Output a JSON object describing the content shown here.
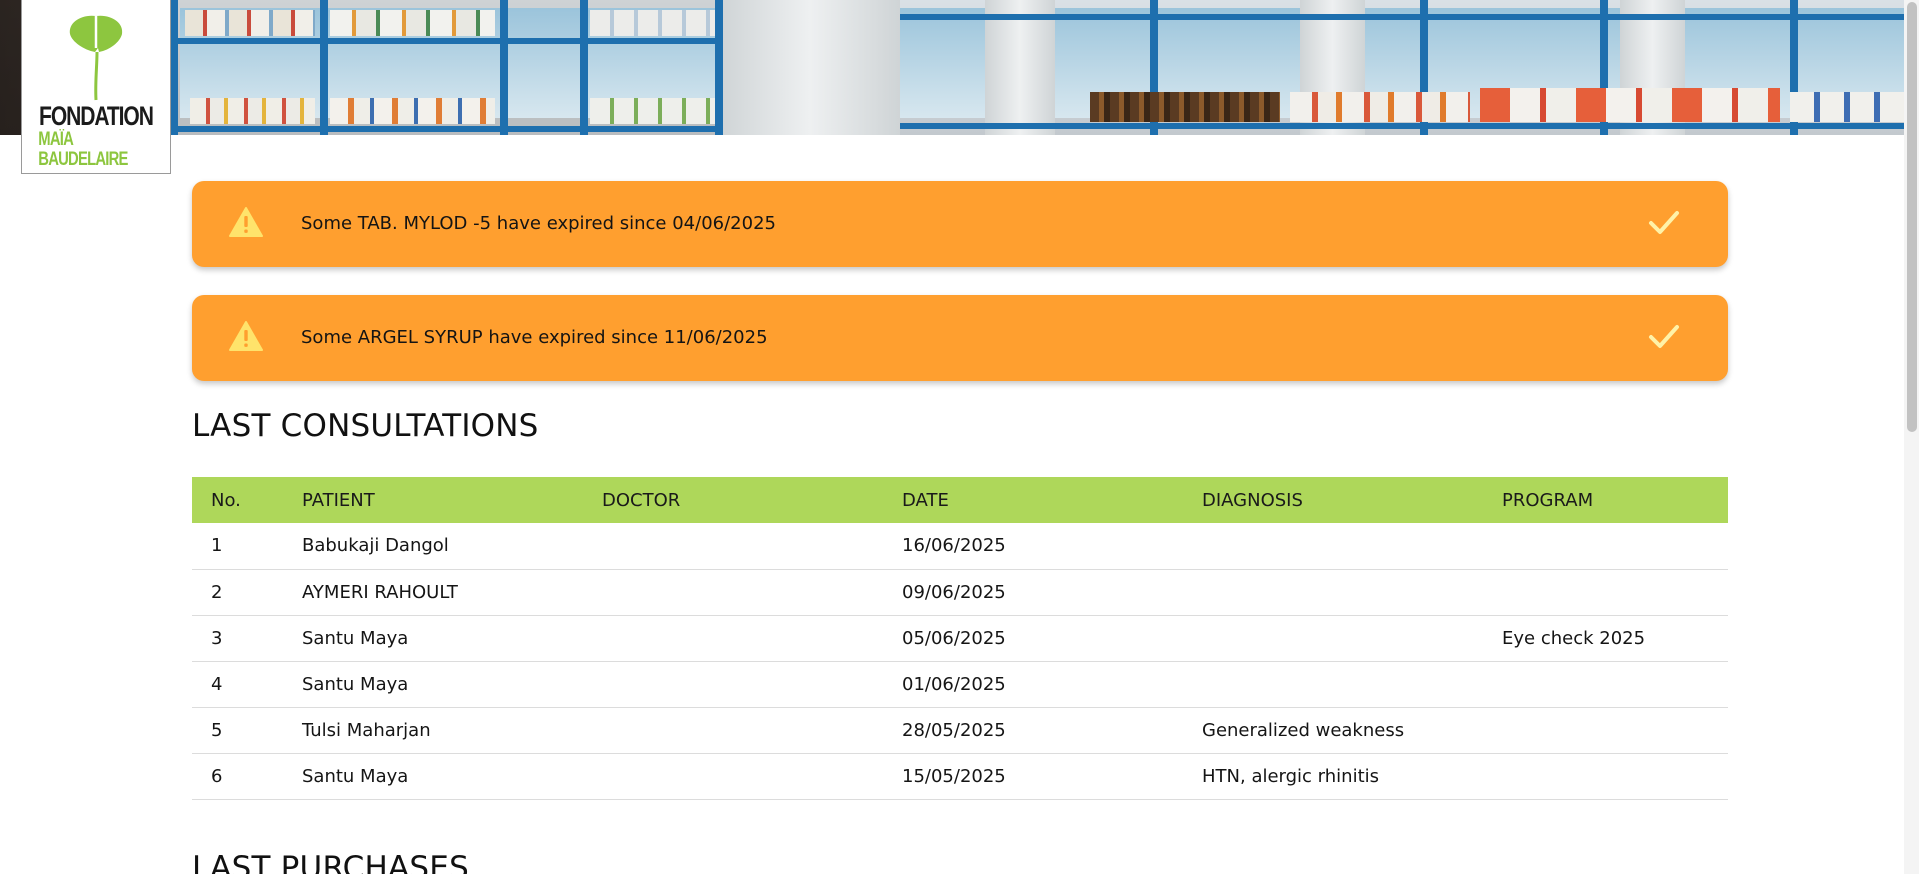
{
  "brand": {
    "line1": "FONDATION",
    "line2": "MAÏA BAUDELAIRE",
    "logo_icon": "ginkgo-leaf-icon",
    "accent_color": "#8dc63f"
  },
  "alerts": [
    {
      "icon": "warning-icon",
      "message": "Some TAB. MYLOD -5 have expired since 04/06/2025",
      "action_icon": "check-icon"
    },
    {
      "icon": "warning-icon",
      "message": "Some ARGEL SYRUP have expired since 11/06/2025",
      "action_icon": "check-icon"
    }
  ],
  "alert_color": "#ff9f2f",
  "consultations": {
    "title": "LAST CONSULTATIONS",
    "header_color": "#aed75a",
    "columns": [
      "No.",
      "PATIENT",
      "DOCTOR",
      "DATE",
      "DIAGNOSIS",
      "PROGRAM"
    ],
    "rows": [
      [
        "1",
        "Babukaji Dangol",
        "",
        "16/06/2025",
        "",
        ""
      ],
      [
        "2",
        "AYMERI RAHOULT",
        "",
        "09/06/2025",
        "",
        ""
      ],
      [
        "3",
        "Santu Maya",
        "",
        "05/06/2025",
        "",
        "Eye check 2025"
      ],
      [
        "4",
        "Santu Maya",
        "",
        "01/06/2025",
        "",
        ""
      ],
      [
        "5",
        "Tulsi Maharjan",
        "",
        "28/05/2025",
        "Generalized weakness",
        ""
      ],
      [
        "6",
        "Santu Maya",
        "",
        "15/05/2025",
        "HTN, alergic rhinitis",
        ""
      ]
    ]
  },
  "purchases": {
    "title": "LAST PURCHASES"
  }
}
